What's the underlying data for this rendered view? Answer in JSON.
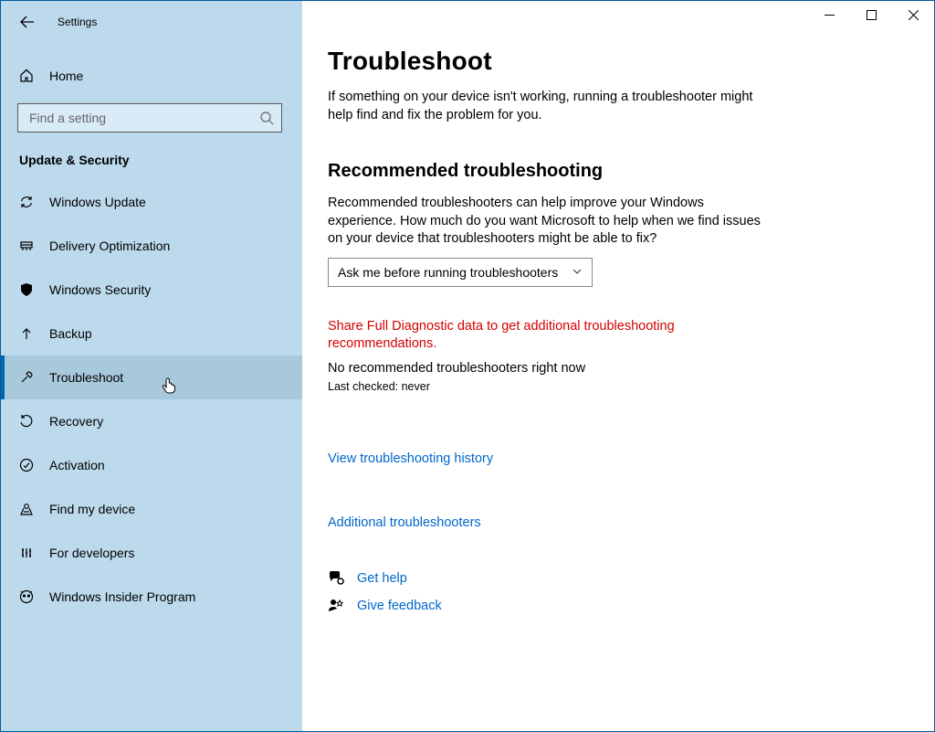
{
  "app": {
    "title": "Settings"
  },
  "sidebar": {
    "home_label": "Home",
    "search_placeholder": "Find a setting",
    "section_title": "Update & Security",
    "items": [
      {
        "label": "Windows Update",
        "icon": "sync"
      },
      {
        "label": "Delivery Optimization",
        "icon": "delivery"
      },
      {
        "label": "Windows Security",
        "icon": "shield"
      },
      {
        "label": "Backup",
        "icon": "backup"
      },
      {
        "label": "Troubleshoot",
        "icon": "wrench",
        "selected": true
      },
      {
        "label": "Recovery",
        "icon": "recovery"
      },
      {
        "label": "Activation",
        "icon": "check-circle"
      },
      {
        "label": "Find my device",
        "icon": "find-device"
      },
      {
        "label": "For developers",
        "icon": "developers"
      },
      {
        "label": "Windows Insider Program",
        "icon": "insider"
      }
    ]
  },
  "main": {
    "title": "Troubleshoot",
    "intro": "If something on your device isn't working, running a troubleshooter might help find and fix the problem for you.",
    "rec_heading": "Recommended troubleshooting",
    "rec_text": "Recommended troubleshooters can help improve your Windows experience. How much do you want Microsoft to help when we find issues on your device that troubleshooters might be able to fix?",
    "dropdown_value": "Ask me before running troubleshooters",
    "warning": "Share Full Diagnostic data to get additional troubleshooting recommendations.",
    "no_rec": "No recommended troubleshooters right now",
    "last_checked": "Last checked: never",
    "history_link": "View troubleshooting history",
    "additional_link": "Additional troubleshooters",
    "get_help": "Get help",
    "give_feedback": "Give feedback"
  }
}
